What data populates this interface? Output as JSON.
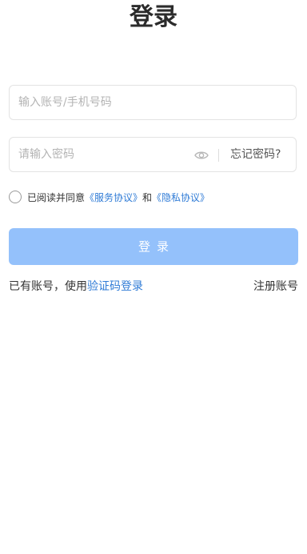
{
  "page": {
    "title": "登录"
  },
  "form": {
    "account_placeholder": "输入账号/手机号码",
    "account_value": "",
    "password_placeholder": "请输入密码",
    "password_value": "",
    "forgot_label": "忘记密码?",
    "eye_icon": "eye-icon"
  },
  "agreement": {
    "prefix": "已阅读并同意",
    "service_link": "《服务协议》",
    "and": "和",
    "privacy_link": "《隐私协议》"
  },
  "login_button": {
    "label": "登录"
  },
  "footer": {
    "sms_prefix": "已有账号，使用",
    "sms_link": "验证码登录",
    "register_label": "注册账号"
  },
  "colors": {
    "accent": "#2f7bd6",
    "button_bg": "#94c1fb"
  }
}
